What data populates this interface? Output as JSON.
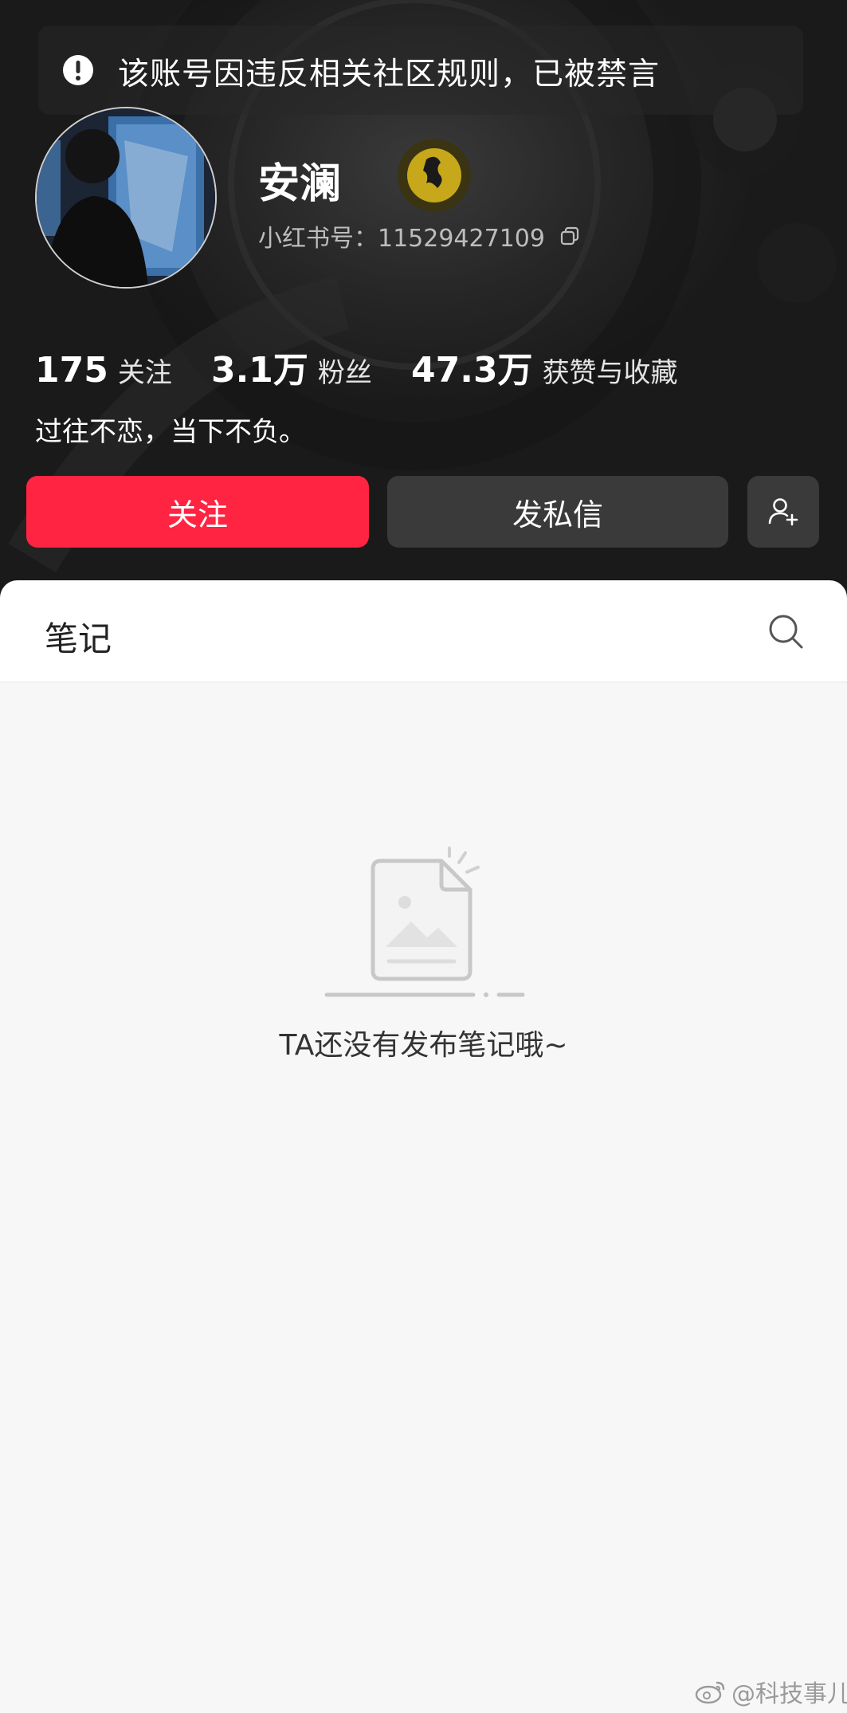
{
  "colors": {
    "accent": "#ff2442",
    "dark_button": "#3a3a3a",
    "hero_bg": "#262626",
    "page_bg": "#f7f7f7"
  },
  "banner": {
    "icon": "exclamation-icon",
    "text": "该账号因违反相关社区规则，已被禁言"
  },
  "profile": {
    "avatar": "avatar",
    "name": "安澜",
    "id_text": "小红书号：11529427109",
    "copy_icon": "copy-icon",
    "bio": "过往不恋，当下不负。"
  },
  "stats": [
    {
      "value": "175",
      "label": "关注"
    },
    {
      "value": "3.1万",
      "label": "粉丝"
    },
    {
      "value": "47.3万",
      "label": "获赞与收藏"
    }
  ],
  "actions": {
    "follow_label": "关注",
    "message_label": "发私信",
    "add_friend_icon": "add-user-icon"
  },
  "tabs": {
    "notes_label": "笔记",
    "search_icon": "search-icon"
  },
  "empty_state": {
    "icon": "empty-document-icon",
    "text": "TA还没有发布笔记哦~"
  },
  "watermark": {
    "icon": "weibo-icon",
    "text": "@科技事儿"
  }
}
